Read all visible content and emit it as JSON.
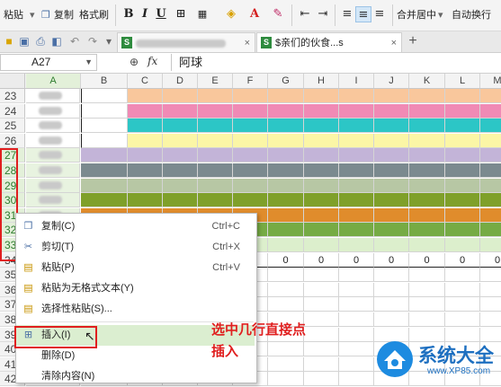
{
  "ribbon": {
    "paste_label": "粘贴",
    "copy_label": "复制",
    "format_painter_label": "格式刷",
    "bold": "B",
    "italic": "I",
    "underline": "U",
    "font_color_letter": "A",
    "merge_center_label": "合并居中",
    "wrap_text_label": "自动换行"
  },
  "tabs": [
    {
      "label": ""
    },
    {
      "label": "$亲们的伙食...s"
    }
  ],
  "formula_bar": {
    "cell_ref": "A27",
    "fx": "fx",
    "content": "阿球"
  },
  "columns": [
    "A",
    "B",
    "C",
    "D",
    "E",
    "F",
    "G",
    "H",
    "I",
    "J",
    "K",
    "L",
    "M"
  ],
  "rows": [
    "23",
    "24",
    "25",
    "26",
    "27",
    "28",
    "29",
    "30",
    "31",
    "32",
    "33",
    "34",
    "35",
    "36",
    "37",
    "38",
    "39",
    "40",
    "41",
    "42"
  ],
  "zero_row": [
    "0",
    "0",
    "0",
    "0",
    "0",
    "0",
    "0",
    "0",
    "0",
    "0",
    "0",
    "0"
  ],
  "context_menu": {
    "items": [
      {
        "label": "复制(C)",
        "shortcut": "Ctrl+C",
        "icon": "copy-icon"
      },
      {
        "label": "剪切(T)",
        "shortcut": "Ctrl+X",
        "icon": "scissors-icon"
      },
      {
        "label": "粘贴(P)",
        "shortcut": "Ctrl+V",
        "icon": "paste-icon"
      },
      {
        "label": "粘贴为无格式文本(Y)",
        "shortcut": "",
        "icon": "paste-text-icon"
      },
      {
        "label": "选择性粘贴(S)...",
        "shortcut": "",
        "icon": "paste-special-icon"
      },
      {
        "label": "插入(I)",
        "shortcut": "",
        "icon": "insert-icon"
      },
      {
        "label": "删除(D)",
        "shortcut": "",
        "icon": ""
      },
      {
        "label": "清除内容(N)",
        "shortcut": "",
        "icon": ""
      }
    ]
  },
  "annotation": {
    "line1": "选中几行直接点",
    "line2": "插入"
  },
  "watermark": {
    "title": "系统大全",
    "url": "www.XP85.com"
  },
  "colors": {
    "row23_25": "#f9c79c",
    "row24": "#f08ab5",
    "row25": "#2cc6c6",
    "row26": "#fbf6a6",
    "row27": "#c3b4d8",
    "row28": "#7b8a8f",
    "row29": "#b7c7a4",
    "row30": "#7fa02a",
    "row31": "#e08c2c",
    "row32": "#76ab44",
    "row33": "#dcefcc",
    "annotation_red": "#e01f1f"
  }
}
